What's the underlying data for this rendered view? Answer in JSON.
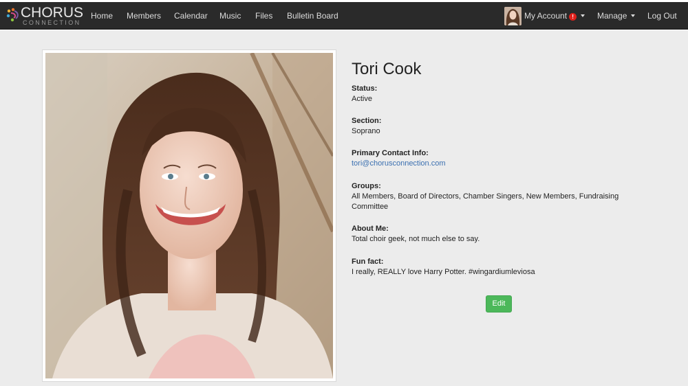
{
  "brand": {
    "name": "CHORUS",
    "sub": "CONNECTION"
  },
  "nav": {
    "home": "Home",
    "members": "Members",
    "calendar": "Calendar",
    "music": "Music",
    "files": "Files",
    "bulletin": "Bulletin Board",
    "my_account": "My Account",
    "alert_count": "!",
    "manage": "Manage",
    "logout": "Log Out"
  },
  "profile": {
    "name": "Tori Cook",
    "status_label": "Status:",
    "status": "Active",
    "section_label": "Section:",
    "section": "Soprano",
    "contact_label": "Primary Contact Info:",
    "contact": "tori@chorusconnection.com",
    "groups_label": "Groups:",
    "groups": "All Members, Board of Directors, Chamber Singers, New Members, Fundraising Committee",
    "about_label": "About Me:",
    "about": "Total choir geek, not much else to say.",
    "funfact_label": "Fun fact:",
    "funfact": "I really, REALLY love Harry Potter. #wingardiumleviosa",
    "edit_label": "Edit"
  },
  "colors": {
    "topbar": "#2a2a2a",
    "page_bg": "#ececec",
    "link": "#3a6fb0",
    "edit_button": "#4cb85a",
    "alert": "#e0201b"
  }
}
